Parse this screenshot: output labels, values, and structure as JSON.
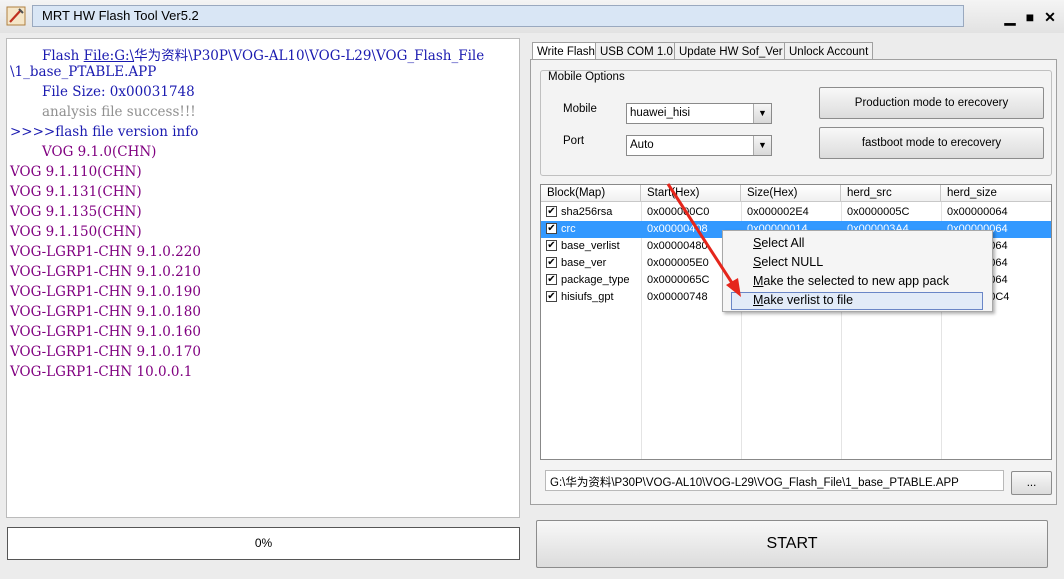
{
  "window": {
    "title": "MRT HW Flash Tool Ver5.2",
    "min": "▁",
    "max": "■",
    "close": "✕"
  },
  "log": {
    "flash_prefix": "Flash ",
    "flash_link": "File:G:\\",
    "flash_path": "华为资料\\P30P\\VOG-AL10\\VOG-L29\\VOG_Flash_File",
    "flash_path2": "\\1_base_PTABLE.APP",
    "file_size": "File Size: 0x00031748",
    "analysis": "analysis file success!!!",
    "version_info": ">>>>flash file version info",
    "versions": [
      "VOG 9.1.0(CHN)",
      "VOG 9.1.110(CHN)",
      "VOG 9.1.131(CHN)",
      "VOG 9.1.135(CHN)",
      "VOG 9.1.150(CHN)",
      "VOG-LGRP1-CHN 9.1.0.220",
      "VOG-LGRP1-CHN 9.1.0.210",
      "VOG-LGRP1-CHN 9.1.0.190",
      "VOG-LGRP1-CHN 9.1.0.180",
      "VOG-LGRP1-CHN 9.1.0.160",
      "VOG-LGRP1-CHN 9.1.0.170",
      "VOG-LGRP1-CHN 10.0.0.1"
    ]
  },
  "progress": {
    "label": "0%",
    "fraction": 0
  },
  "tabs": [
    {
      "label": "Write Flash"
    },
    {
      "label": "USB COM 1.0"
    },
    {
      "label": "Update HW Sof_Ver"
    },
    {
      "label": "Unlock Account"
    }
  ],
  "mobile_options": {
    "title": "Mobile Options",
    "mobile_label": "Mobile",
    "mobile_value": "huawei_hisi",
    "port_label": "Port",
    "port_value": "Auto",
    "production_button": "Production mode to erecovery",
    "fastboot_button": "fastboot mode to erecovery"
  },
  "table": {
    "columns": [
      "Block(Map)",
      "Start(Hex)",
      "Size(Hex)",
      "herd_src",
      "herd_size"
    ],
    "rows": [
      {
        "block": "sha256rsa",
        "start": "0x000000C0",
        "size": "0x000002E4",
        "src": "0x0000005C",
        "hsize": "0x00000064",
        "checked": true
      },
      {
        "block": "crc",
        "start": "0x00000408",
        "size": "0x00000014",
        "src": "0x000003A4",
        "hsize": "0x00000064",
        "checked": true
      },
      {
        "block": "base_verlist",
        "start": "0x00000480",
        "size": "",
        "src": "",
        "hsize": "0x00000064",
        "checked": true
      },
      {
        "block": "base_ver",
        "start": "0x000005E0",
        "size": "",
        "src": "",
        "hsize": "0x00000064",
        "checked": true
      },
      {
        "block": "package_type",
        "start": "0x0000065C",
        "size": "",
        "src": "",
        "hsize": "0x00000064",
        "checked": true
      },
      {
        "block": "hisiufs_gpt",
        "start": "0x00000748",
        "size": "",
        "src": "",
        "hsize": "0x000000C4",
        "checked": true
      }
    ],
    "selected_row": 1
  },
  "context_menu": {
    "items": [
      {
        "key": "S",
        "rest": "elect All"
      },
      {
        "key": "S",
        "rest": "elect NULL"
      },
      {
        "key": "M",
        "rest": "ake the selected to new app pack"
      },
      {
        "key": "M",
        "rest": "ake verlist to file"
      }
    ],
    "highlighted": 3
  },
  "path_field": "G:\\华为资料\\P30P\\VOG-AL10\\VOG-L29\\VOG_Flash_File\\1_base_PTABLE.APP",
  "browse_label": "...",
  "start_label": "START",
  "colors": {
    "selection": "#3399ff",
    "version_text": "#800080",
    "link_text": "#1a1ab0",
    "arrow": "#e5261c"
  }
}
